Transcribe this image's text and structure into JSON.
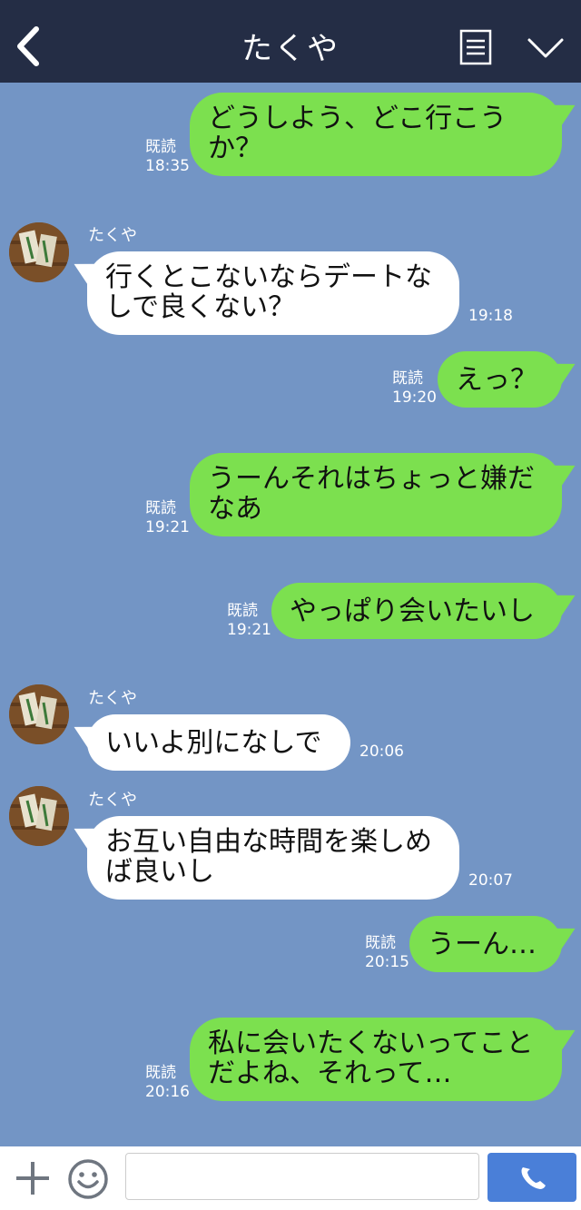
{
  "header": {
    "title": "たくや",
    "back_icon": "chevron-left-icon",
    "notes_icon": "notes-icon",
    "menu_icon": "chevron-down-icon",
    "background": "#242d45"
  },
  "chat_background": "#7395c5",
  "outgoing_color": "#7ce04f",
  "incoming_color": "#ffffff",
  "messages": [
    {
      "dir": "out",
      "text": "どうしよう、どこ行こうか？",
      "read": "既読",
      "time": "18:35"
    },
    {
      "dir": "in",
      "sender": "たくや",
      "text": "行くとこないならデートなしで良くない？",
      "time": "19:18"
    },
    {
      "dir": "out",
      "text": "えっ？",
      "read": "既読",
      "time": "19:20"
    },
    {
      "dir": "out",
      "text": "うーんそれはちょっと嫌だなあ",
      "read": "既読",
      "time": "19:21"
    },
    {
      "dir": "out",
      "text": "やっぱり会いたいし",
      "read": "既読",
      "time": "19:21"
    },
    {
      "dir": "in",
      "sender": "たくや",
      "text": "いいよ別になしで",
      "time": "20:06"
    },
    {
      "dir": "in",
      "sender": "たくや",
      "text": "お互い自由な時間を楽しめば良いし",
      "time": "20:07"
    },
    {
      "dir": "out",
      "text": "うーん…",
      "read": "既読",
      "time": "20:15"
    },
    {
      "dir": "out",
      "text": "私に会いたくないってことだよね、それって…",
      "read": "既読",
      "time": "20:16"
    }
  ],
  "footer": {
    "plus_icon": "plus-icon",
    "sticker_icon": "smile-icon",
    "input_value": "",
    "call_icon": "phone-icon",
    "call_color": "#4a7fd8"
  }
}
